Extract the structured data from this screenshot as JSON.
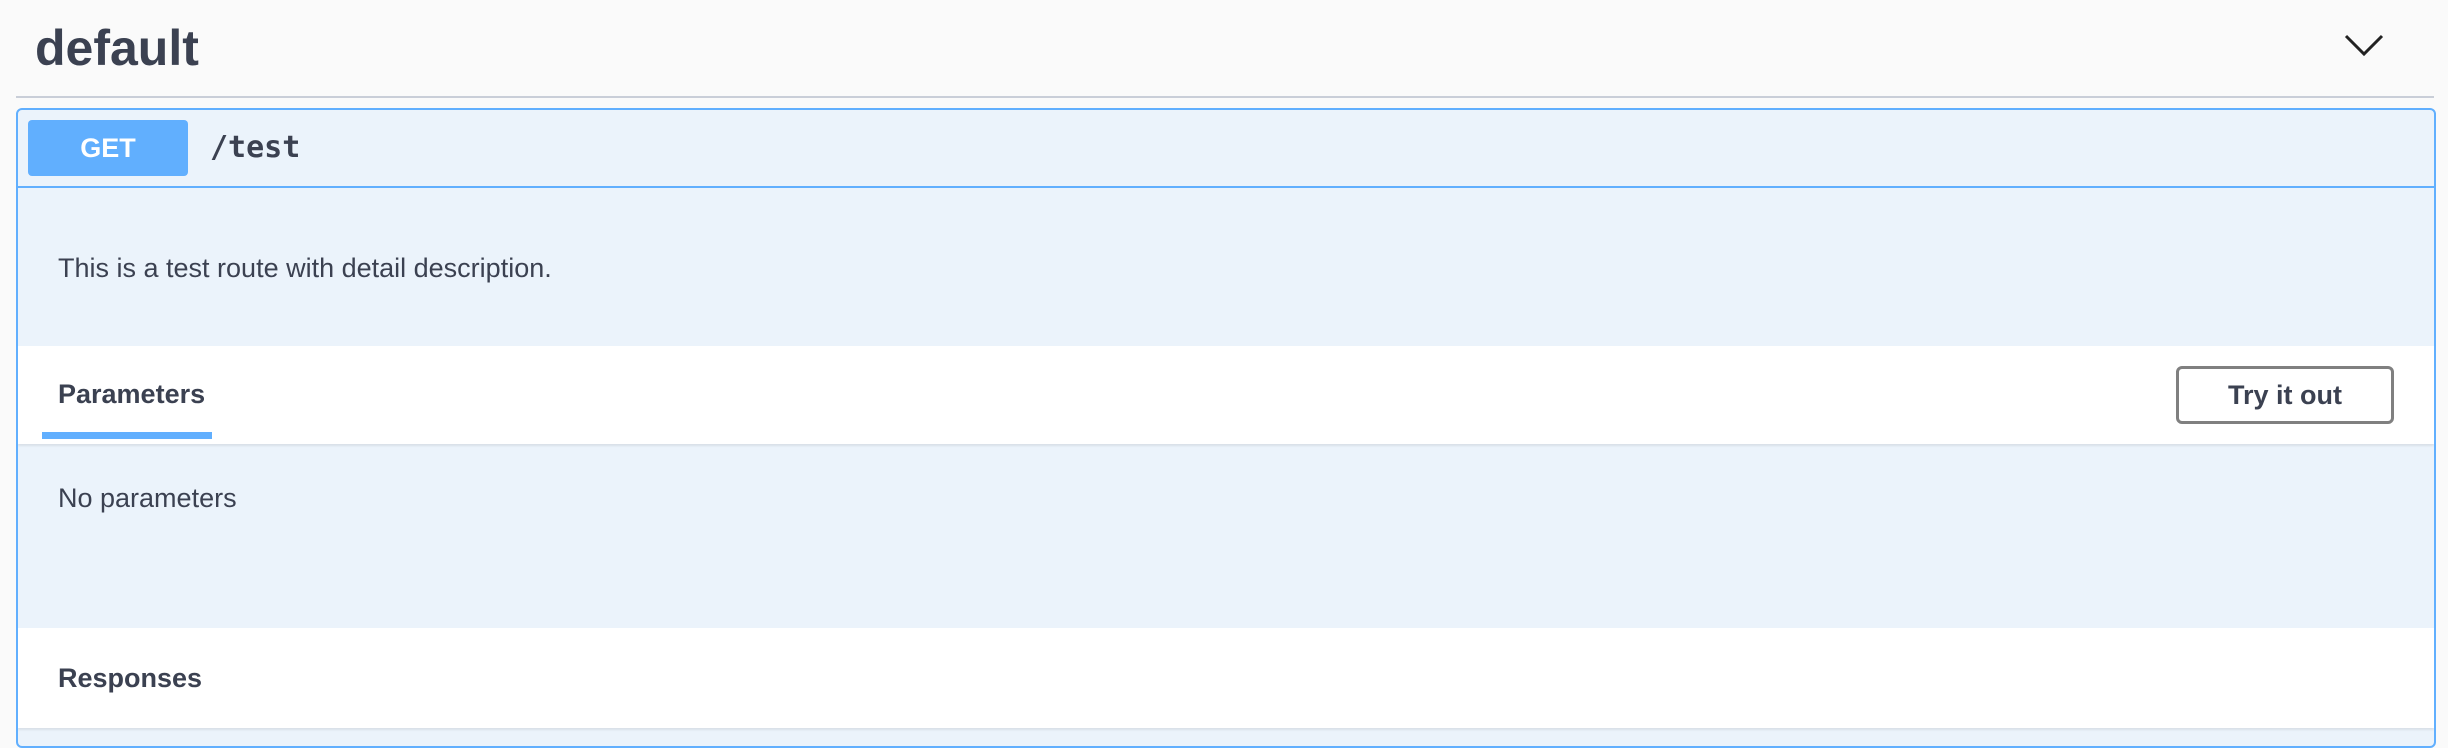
{
  "tag": {
    "title": "default",
    "toggle_icon": "chevron-down-icon"
  },
  "operation": {
    "method": "GET",
    "method_color": "#61affe",
    "path": "/test",
    "description": "This is a test route with detail description."
  },
  "parameters": {
    "tab_label": "Parameters",
    "try_it_out_label": "Try it out",
    "empty_text": "No parameters"
  },
  "responses": {
    "label": "Responses"
  }
}
